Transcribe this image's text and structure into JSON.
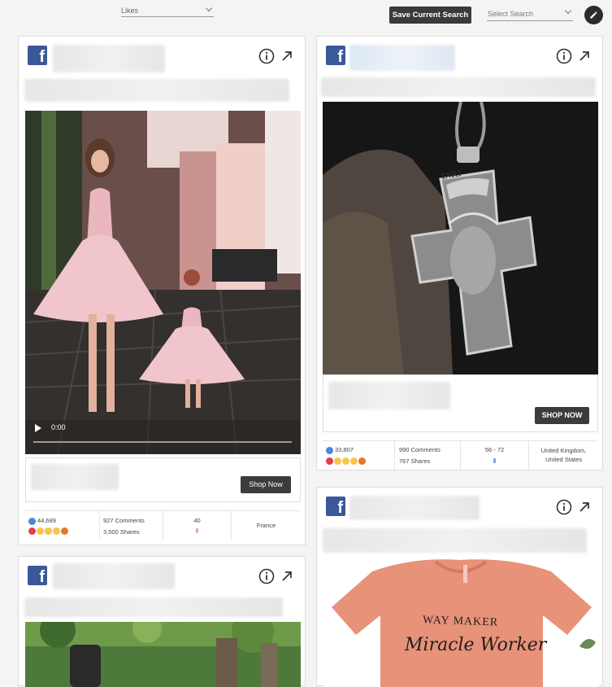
{
  "toolbar": {
    "sort_value": "Likes",
    "save_label": "Save Current Search",
    "saved_search_placeholder": "Select Search"
  },
  "cards": [
    {
      "video_time": "0:00",
      "cta": "Shop Now",
      "likes": "44,689",
      "comments": "927 Comments",
      "shares": "3,500 Shares",
      "age": "40",
      "country": "France"
    },
    {
      "image_caption": "INRI",
      "cta": "SHOP NOW",
      "likes": "33,807",
      "comments": "990 Comments",
      "shares": "767 Shares",
      "age": "56 - 72",
      "country": "United Kingdom, United States"
    },
    {
      "shirt_line1": "WAY MAKER",
      "shirt_line2": "Miracle Worker"
    },
    {}
  ],
  "colors": {
    "facebook": "#3b5998",
    "dark_button": "#3c3c3c"
  }
}
